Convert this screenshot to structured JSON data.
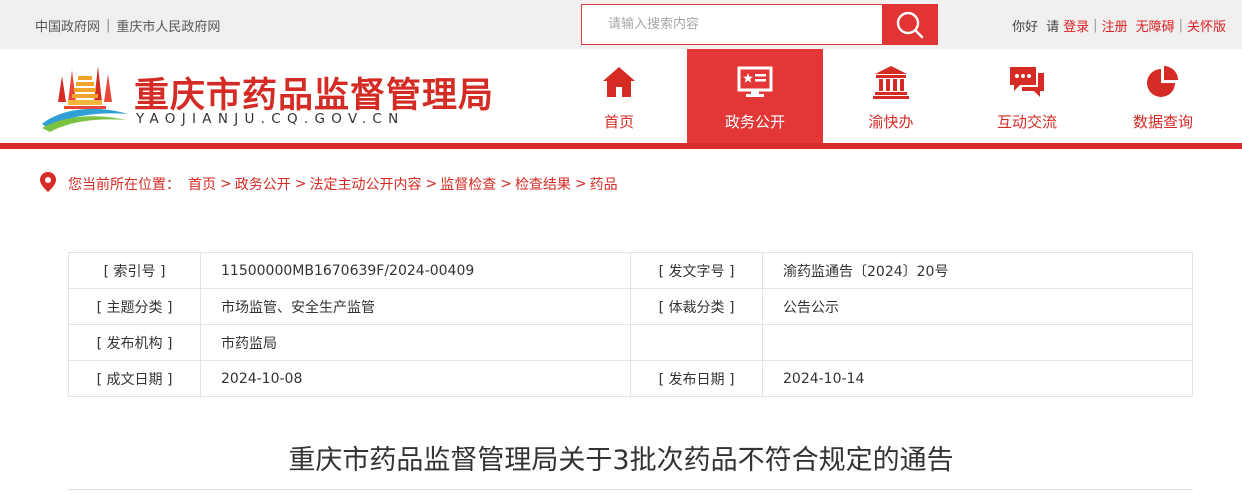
{
  "topbar": {
    "gov_link": "中国政府网",
    "city_link": "重庆市人民政府网",
    "search_placeholder": "请输入搜索内容",
    "greeting": "你好",
    "please": "请",
    "login": "登录",
    "register": "注册",
    "accessibility": "无障碍",
    "elderly": "关怀版"
  },
  "header": {
    "title": "重庆市药品监督管理局",
    "domain": "YAOJIANJU.CQ.GOV.CN"
  },
  "nav": [
    {
      "label": "首页",
      "icon": "home-icon"
    },
    {
      "label": "政务公开",
      "icon": "monitor-star-icon"
    },
    {
      "label": "渝快办",
      "icon": "government-building-icon"
    },
    {
      "label": "互动交流",
      "icon": "chat-bubbles-icon"
    },
    {
      "label": "数据查询",
      "icon": "pie-chart-icon"
    }
  ],
  "breadcrumb": {
    "prefix": "您当前所在位置：",
    "items": [
      "首页",
      "政务公开",
      "法定主动公开内容",
      "监督检查",
      "检查结果",
      "药品"
    ],
    "separator": ">"
  },
  "meta": {
    "index_label": "[ 索引号 ]",
    "index_value": "11500000MB1670639F/2024-00409",
    "doc_no_label": "[ 发文字号 ]",
    "doc_no_value": "渝药监通告〔2024〕20号",
    "topic_label": "[ 主题分类 ]",
    "topic_value": "市场监管、安全生产监管",
    "genre_label": "[ 体裁分类 ]",
    "genre_value": "公告公示",
    "issuer_label": "[ 发布机构 ]",
    "issuer_value": "市药监局",
    "created_label": "[ 成文日期 ]",
    "created_value": "2024-10-08",
    "published_label": "[ 发布日期 ]",
    "published_value": "2024-10-14"
  },
  "article": {
    "title": "重庆市药品监督管理局关于3批次药品不符合规定的通告"
  },
  "colors": {
    "brand_red": "#d42b25",
    "nav_active": "#e33737",
    "topbar_bg": "#f0f0f0"
  }
}
